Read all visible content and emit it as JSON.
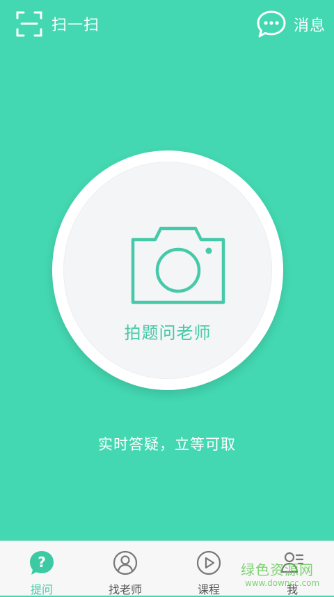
{
  "header": {
    "scan_label": "扫一扫",
    "messages_label": "消息"
  },
  "main": {
    "ask_label": "拍题问老师",
    "tagline": "实时答疑，立等可取"
  },
  "tabs": [
    {
      "label": "提问",
      "icon": "question-bubble-icon",
      "active": true
    },
    {
      "label": "找老师",
      "icon": "teacher-avatar-icon",
      "active": false
    },
    {
      "label": "课程",
      "icon": "play-icon",
      "active": false
    },
    {
      "label": "我",
      "icon": "profile-list-icon",
      "active": false
    }
  ],
  "watermark": {
    "main": "绿色资源网",
    "sub": "www.downcc.com"
  },
  "colors": {
    "background": "#43d8b1",
    "accent": "#3ccaa5",
    "tab_bar": "#f7f7f7"
  }
}
